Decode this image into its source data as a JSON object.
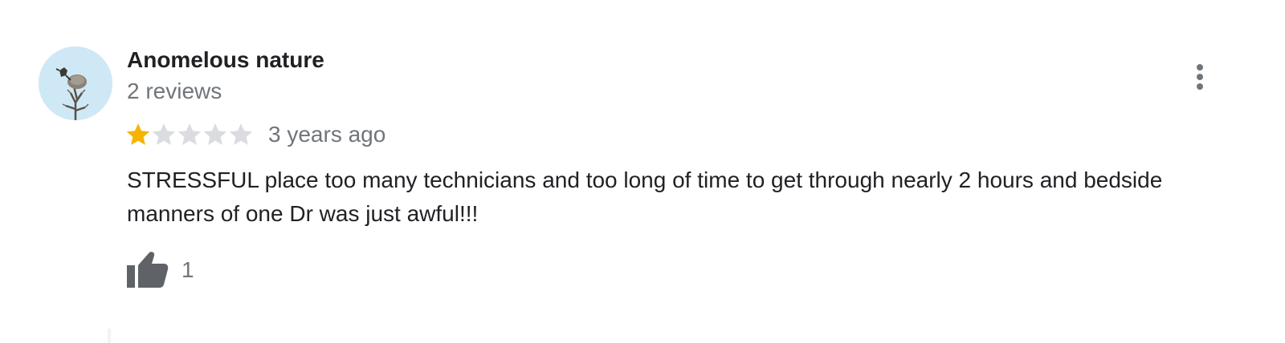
{
  "review": {
    "author": {
      "name": "Anomelous nature",
      "meta": "2 reviews",
      "avatar_icon": "bird-on-tree-avatar"
    },
    "menu_icon": "more-vert-icon",
    "rating": {
      "value": 1,
      "max": 5,
      "filled_color": "#f4b400",
      "empty_color": "#dadce0"
    },
    "time": "3 years ago",
    "text": "STRESSFUL place too many technicians and too long of time to get through nearly 2 hours and bedside manners of one Dr was just awful!!!",
    "like": {
      "icon": "thumbs-up-icon",
      "count": "1"
    }
  }
}
